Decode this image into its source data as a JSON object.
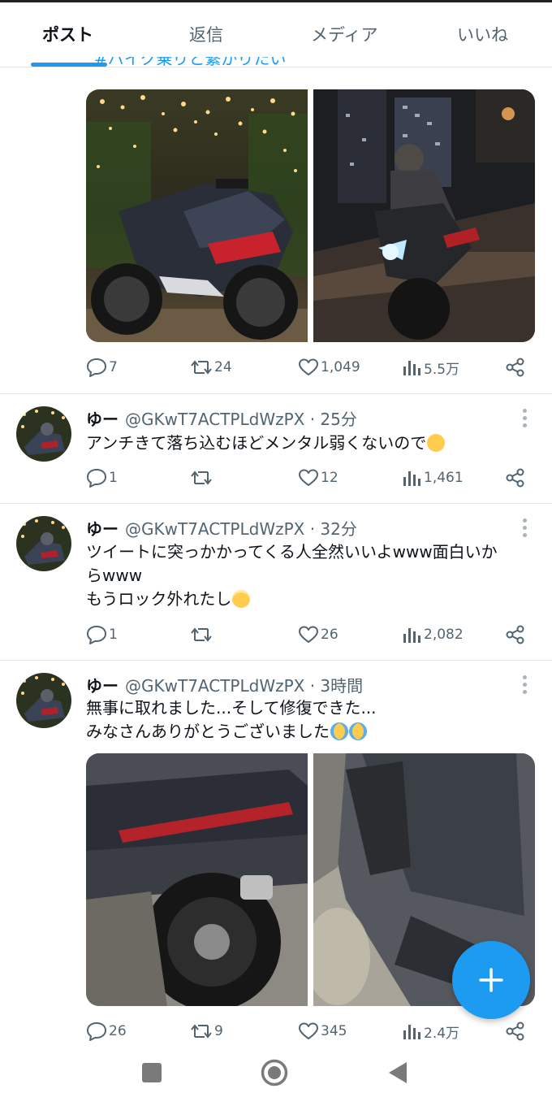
{
  "tabs": [
    {
      "label": "ポスト",
      "active": true
    },
    {
      "label": "返信"
    },
    {
      "label": "メディア"
    },
    {
      "label": "いいね"
    }
  ],
  "hashtag": "#バイク乗りと繋がりたい",
  "accent_color": "#1d9bf0",
  "post0": {
    "images": [
      "motorcycle-night-lights",
      "rider-night-street"
    ],
    "actions": {
      "replies": "7",
      "reposts": "24",
      "likes": "1,049",
      "views": "5.5万"
    }
  },
  "tweets": [
    {
      "name": "ゆー",
      "handle": "@GKwT7ACTPLdWzPX",
      "time": "· 25分",
      "lines": [
        "アンチきて落ち込むほどメンタル弱くないので"
      ],
      "emoji": [
        "pleading-face"
      ],
      "actions": {
        "replies": "1",
        "reposts": "",
        "likes": "12",
        "views": "1,461"
      }
    },
    {
      "name": "ゆー",
      "handle": "@GKwT7ACTPLdWzPX",
      "time": "· 32分",
      "lines": [
        "ツイートに突っかかってくる人全然いいよwww面白いか",
        "らwww",
        "もうロック外れたし"
      ],
      "emoji": [
        "smiling-face-with-halo"
      ],
      "actions": {
        "replies": "1",
        "reposts": "",
        "likes": "26",
        "views": "2,082"
      }
    },
    {
      "name": "ゆー",
      "handle": "@GKwT7ACTPLdWzPX",
      "time": "· 3時間",
      "lines": [
        "無事に取れました...そして修復できた...",
        "みなさんありがとうございました"
      ],
      "emoji": [
        "loudly-crying-face",
        "loudly-crying-face"
      ],
      "images": [
        "motorcycle-rear-tire",
        "motorcycle-side-panel"
      ],
      "actions": {
        "replies": "26",
        "reposts": "9",
        "likes": "345",
        "views": "2.4万"
      }
    }
  ],
  "fab": {
    "icon": "plus-icon"
  },
  "navbar": {
    "icons": [
      "recents-square-icon",
      "home-circle-icon",
      "back-triangle-icon"
    ]
  }
}
